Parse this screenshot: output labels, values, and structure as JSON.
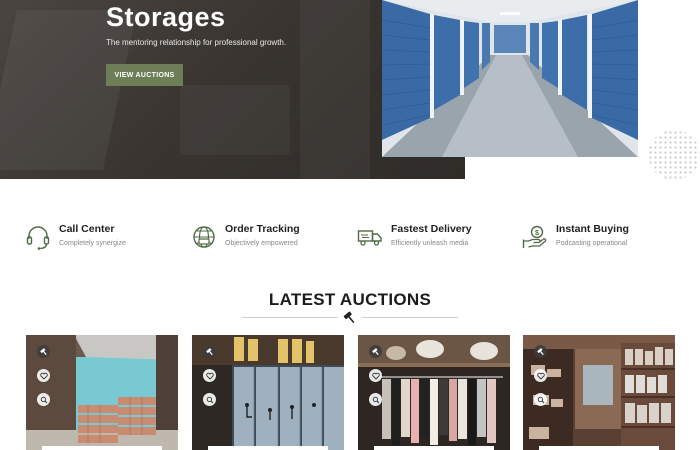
{
  "hero": {
    "title": "Storages",
    "subtitle": "The mentoring relationship for professional growth.",
    "cta_label": "VIEW AUCTIONS"
  },
  "features": [
    {
      "title": "Call Center",
      "subtitle": "Completely synergize",
      "icon": "headset-icon"
    },
    {
      "title": "Order Tracking",
      "subtitle": "Objectively empowered",
      "icon": "globe-tracking-icon"
    },
    {
      "title": "Fastest Delivery",
      "subtitle": "Efficiently unleash media",
      "icon": "truck-icon"
    },
    {
      "title": "Instant Buying",
      "subtitle": "Podcasting operational",
      "icon": "money-hand-icon"
    }
  ],
  "auctions": {
    "heading": "LATEST AUCTIONS",
    "divider_icon": "gavel-icon",
    "card_actions": [
      "gavel-icon",
      "heart-icon",
      "zoom-icon"
    ],
    "cards": [
      {
        "image": "stacked-pallets-photo"
      },
      {
        "image": "storage-lockers-photo"
      },
      {
        "image": "clothing-rack-photo"
      },
      {
        "image": "warehouse-shelves-photo"
      }
    ]
  },
  "colors": {
    "accent": "#6d7e59",
    "hero_bg": "#3a3531",
    "icon_green": "#4f6a44",
    "heading": "#1c1c1c"
  }
}
